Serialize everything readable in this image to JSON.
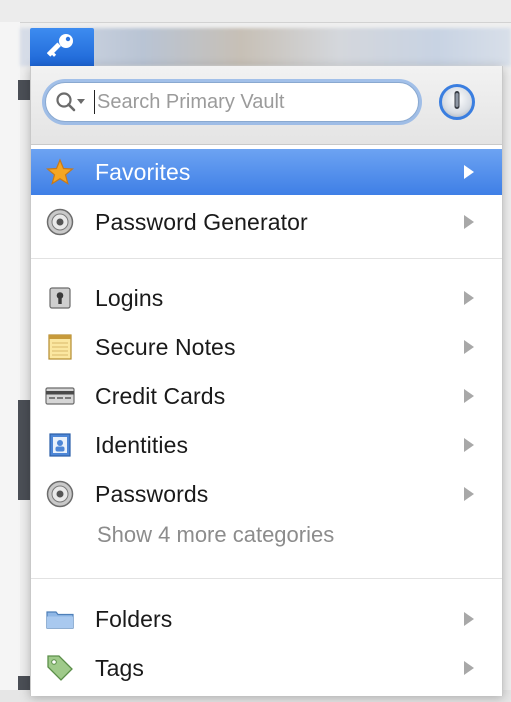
{
  "search": {
    "placeholder": "Search Primary Vault"
  },
  "menu": {
    "top_items": [
      {
        "label": "Favorites",
        "icon": "star-icon",
        "selected": true
      },
      {
        "label": "Password Generator",
        "icon": "password-generator-icon",
        "selected": false
      }
    ],
    "category_items": [
      {
        "label": "Logins",
        "icon": "login-icon"
      },
      {
        "label": "Secure Notes",
        "icon": "secure-note-icon"
      },
      {
        "label": "Credit Cards",
        "icon": "credit-card-icon"
      },
      {
        "label": "Identities",
        "icon": "identity-icon"
      },
      {
        "label": "Passwords",
        "icon": "password-icon"
      }
    ],
    "more_categories": "Show 4 more categories",
    "bottom_items": [
      {
        "label": "Folders",
        "icon": "folder-icon"
      },
      {
        "label": "Tags",
        "icon": "tag-icon"
      }
    ]
  },
  "colors": {
    "accent": "#3f7fe6",
    "selected_bg": "#5b94ec",
    "key_tab": "#2a73e0"
  }
}
